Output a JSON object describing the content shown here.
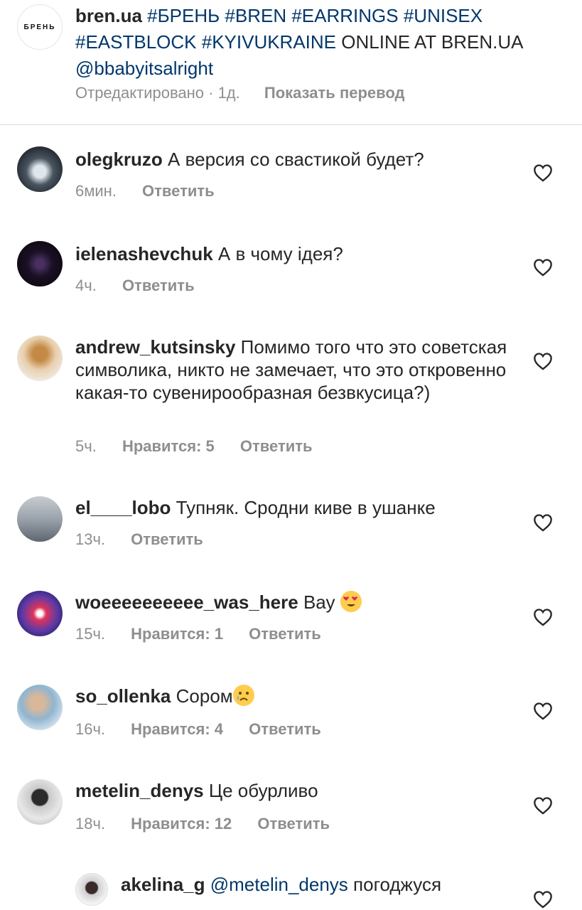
{
  "caption": {
    "avatar_text": "БРЕНЬ",
    "username": "bren.ua",
    "hashtags": "#БРЕНЬ #BREN #EARRINGS #UNISEX #EASTBLOCK #KYIVUKRAINE",
    "text": "ONLINE AT BREN.UA",
    "mention": "@bbabyitsalright",
    "edited": "Отредактировано · 1д.",
    "translate": "Показать перевод"
  },
  "comments": [
    {
      "username": "olegkruzo",
      "text": "А версия со свастикой будет?",
      "time": "6мин.",
      "likes": "",
      "reply": "Ответить"
    },
    {
      "username": "ielenashevchuk",
      "text": "А в чому ідея?",
      "time": "4ч.",
      "likes": "",
      "reply": "Ответить"
    },
    {
      "username": "andrew_kutsinsky",
      "text": "Помимо того что это советская символика, никто не замечает, что это откровенно какая-то сувенирообразная безвкусица?)",
      "time": "5ч.",
      "likes": "Нравится: 5",
      "reply": "Ответить"
    },
    {
      "username": "el____lobo",
      "text": "Тупняк. Сродни киве в ушанке",
      "time": "13ч.",
      "likes": "",
      "reply": "Ответить"
    },
    {
      "username": "woeeeeeeeeee_was_here",
      "text": "Вау",
      "time": "15ч.",
      "likes": "Нравится: 1",
      "reply": "Ответить"
    },
    {
      "username": "so_ollenka",
      "text": "Сором",
      "time": "16ч.",
      "likes": "Нравится: 4",
      "reply": "Ответить"
    },
    {
      "username": "metelin_denys",
      "text": "Це обурливо",
      "time": "18ч.",
      "likes": "Нравится: 12",
      "reply": "Ответить"
    }
  ],
  "reply_comment": {
    "username": "akelina_g",
    "mention": "@metelin_denys",
    "text": "погоджуся"
  },
  "icons": {
    "heart": "heart-outline-icon",
    "emoji_love": "heart-eyes-emoji-icon",
    "emoji_cry": "crying-face-emoji-icon"
  },
  "colors": {
    "link": "#00376b",
    "muted": "#8e8e8e",
    "text": "#262626"
  }
}
